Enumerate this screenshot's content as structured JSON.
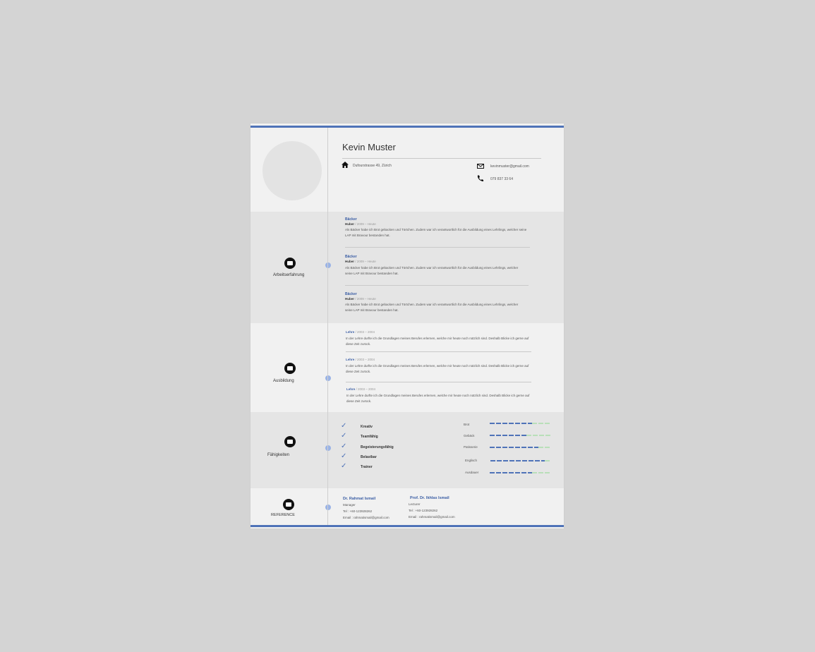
{
  "header": {
    "name": "Kevin Muster",
    "address": "Dufourstrasse 49, Zürich",
    "email": "kevinmuster@gmail.com",
    "phone": "079 837 33 64"
  },
  "sections": {
    "work": {
      "label": "Arbeitserfahrung",
      "entries": [
        {
          "title": "Bäcker",
          "company": "Huber",
          "period": "/ 2009 – Heute",
          "text": "Als Bäcker habe ich Brot gebacken und Törtchen. Zudem war ich verantwortlich für die Ausbildung eines Lehrlings, welcher seine LAP mit Bravour bestanden hat."
        },
        {
          "title": "Bäcker",
          "company": "Huber",
          "period": "/ 2009 – Heute",
          "text": "Als Bäcker habe ich Brot gebacken und Törtchen. Zudem war ich verantwortlich für die Ausbildung eines Lehrlings, welcher seine LAP mit Bravour bestanden hat."
        },
        {
          "title": "Bäcker",
          "company": "Huber",
          "period": "/ 2009 – Heute",
          "text": "Als Bäcker habe ich Brot gebacken und Törtchen. Zudem war ich verantwortlich für die Ausbildung eines Lehrlings, welcher seine LAP mit Bravour bestanden hat."
        }
      ]
    },
    "education": {
      "label": "Ausbildung",
      "entries": [
        {
          "title": "Lehre",
          "period": "/ 2003 – 2004",
          "text": "In der Lehre durfte ich die Grundlagen meines Berufes erlernen, welche mir heute noch nützlich sind. Deshalb Blicke ich gerne auf diese Zeit zurück."
        },
        {
          "title": "Lehre",
          "period": "/ 2003 – 2004",
          "text": "In der Lehre durfte ich die Grundlagen meines Berufes erlernen, welche mir heute noch nützlich sind. Deshalb Blicke ich gerne auf diese Zeit zurück."
        },
        {
          "title": "Lehre",
          "period": "/ 2003 – 2004",
          "text": "In der Lehre durfte ich die Grundlagen meines Berufes erlernen, welche mir heute noch nützlich sind. Deshalb Blicke ich gerne auf diese Zeit zurück."
        }
      ]
    },
    "skills": {
      "label": "Fähigkeiten",
      "soft": [
        "Kreativ",
        "Teamfähig",
        "Begeisterungsfähig",
        "Belastbar",
        "Trainer"
      ],
      "levels": [
        {
          "name": "Brot",
          "value": 0.7
        },
        {
          "name": "Gebäck",
          "value": 0.6
        },
        {
          "name": "Patisserie",
          "value": 0.8
        },
        {
          "name": "Englisch",
          "value": 0.9
        },
        {
          "name": "Ausdauer",
          "value": 0.7
        }
      ]
    },
    "reference": {
      "label": "REFERENCE",
      "people": [
        {
          "name": "Dr. Rahmat Ismail",
          "role": "Manager",
          "tel": "Tel : +60-123928262",
          "email": "Email : rahmatismail@gmail.com"
        },
        {
          "name": "Prof. Dr. Ikhlas Ismail",
          "role": "Lecturer",
          "tel": "Tel : +60-123928262",
          "email": "Email : rahmatismail@gmail.com"
        }
      ]
    }
  }
}
